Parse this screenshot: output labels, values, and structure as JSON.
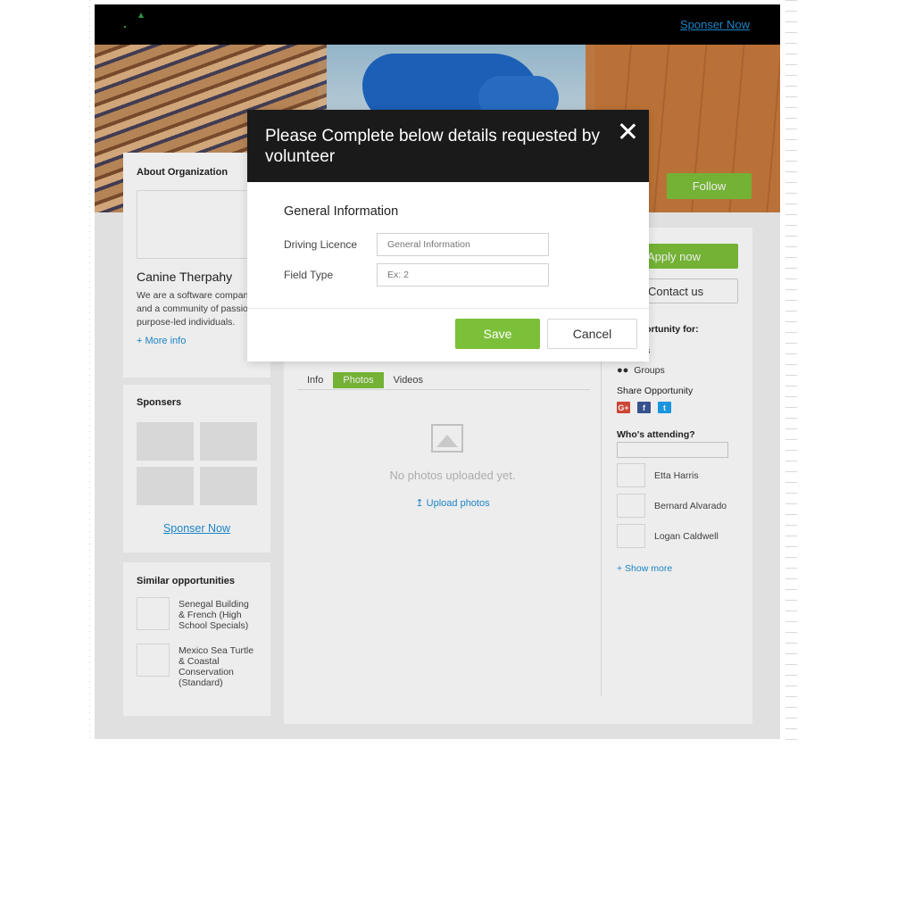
{
  "topbar": {
    "sponsor_link": "Sponser Now"
  },
  "banner": {
    "follow_label": "Follow"
  },
  "about": {
    "heading": "About Organization",
    "org_name": "Canine Therpahy",
    "description": "We are a software company and a community of passionate, purpose-led individuals.",
    "more_info": "+ More info"
  },
  "sponsers": {
    "heading": "Sponsers",
    "link": "Sponser Now"
  },
  "similar": {
    "heading": "Similar opportunities",
    "items": [
      "Senegal Building & French (High School Specials)",
      "Mexico Sea Turtle & Coastal Conservation (Standard)"
    ]
  },
  "main": {
    "tabs": [
      "Info",
      "Photos",
      "Videos"
    ],
    "active_tab": "Photos",
    "empty_text": "No photos uploaded yet.",
    "upload_label": "Upload photos",
    "upload_icon": "upload-arrow-icon"
  },
  "side": {
    "apply_label": "Apply now",
    "contact_label": "Contact us",
    "opportunity_for": "er opportunity for:",
    "individuals": "lividuals",
    "groups": "Groups",
    "share": "Share Opportunity",
    "social": [
      "G+",
      "f",
      "t"
    ],
    "attending": "Who's attending?",
    "people": [
      "Etta Harris",
      "Bernard Alvarado",
      "Logan Caldwell"
    ],
    "show_more": "+ Show more"
  },
  "modal": {
    "title": "Please Complete below details requested by volunteer",
    "section": "General Information",
    "fields": [
      {
        "label": "Driving Licence",
        "placeholder": "General Information"
      },
      {
        "label": "Field Type",
        "placeholder": "Ex: 2"
      }
    ],
    "save_label": "Save",
    "cancel_label": "Cancel"
  },
  "colors": {
    "accent": "#7cc03a",
    "link": "#1e8fd6",
    "header": "#000000",
    "modal_header": "#1a1a1a"
  }
}
